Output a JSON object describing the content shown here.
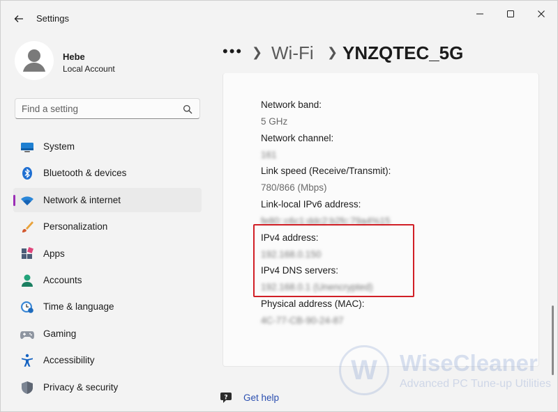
{
  "app": {
    "title": "Settings"
  },
  "user": {
    "name": "Hebe",
    "account_type": "Local Account"
  },
  "search": {
    "placeholder": "Find a setting"
  },
  "sidebar": {
    "items": [
      {
        "label": "System",
        "icon": "system-icon",
        "active": false
      },
      {
        "label": "Bluetooth & devices",
        "icon": "bluetooth-icon",
        "active": false
      },
      {
        "label": "Network & internet",
        "icon": "wifi-icon",
        "active": true
      },
      {
        "label": "Personalization",
        "icon": "brush-icon",
        "active": false
      },
      {
        "label": "Apps",
        "icon": "apps-icon",
        "active": false
      },
      {
        "label": "Accounts",
        "icon": "accounts-icon",
        "active": false
      },
      {
        "label": "Time & language",
        "icon": "time-language-icon",
        "active": false
      },
      {
        "label": "Gaming",
        "icon": "gamepad-icon",
        "active": false
      },
      {
        "label": "Accessibility",
        "icon": "accessibility-icon",
        "active": false
      },
      {
        "label": "Privacy & security",
        "icon": "shield-icon",
        "active": false
      }
    ]
  },
  "breadcrumb": {
    "more": "•••",
    "parent": "Wi-Fi",
    "current": "YNZQTEC_5G"
  },
  "properties": {
    "network_band": {
      "label": "Network band:",
      "value": "5 GHz"
    },
    "network_channel": {
      "label": "Network channel:",
      "value": "161"
    },
    "link_speed": {
      "label": "Link speed (Receive/Transmit):",
      "value": "780/866 (Mbps)"
    },
    "ipv6": {
      "label": "Link-local IPv6 address:",
      "value": "fe80::c6c1:ddc2:b2fc:79a4%15"
    },
    "ipv4": {
      "label": "IPv4 address:",
      "value": "192.168.0.150"
    },
    "dns": {
      "label": "IPv4 DNS servers:",
      "value": "192.168.0.1 (Unencrypted)"
    },
    "mac": {
      "label": "Physical address (MAC):",
      "value": "4C-77-CB-90-24-87"
    }
  },
  "help": {
    "label": "Get help"
  },
  "watermark": {
    "brand": "WiseCleaner",
    "tagline": "Advanced PC Tune-up Utilities",
    "logo_letter": "W"
  },
  "colors": {
    "accent": "#9b2fb6",
    "highlight_box": "#d11f26",
    "link": "#2b4fb0"
  }
}
